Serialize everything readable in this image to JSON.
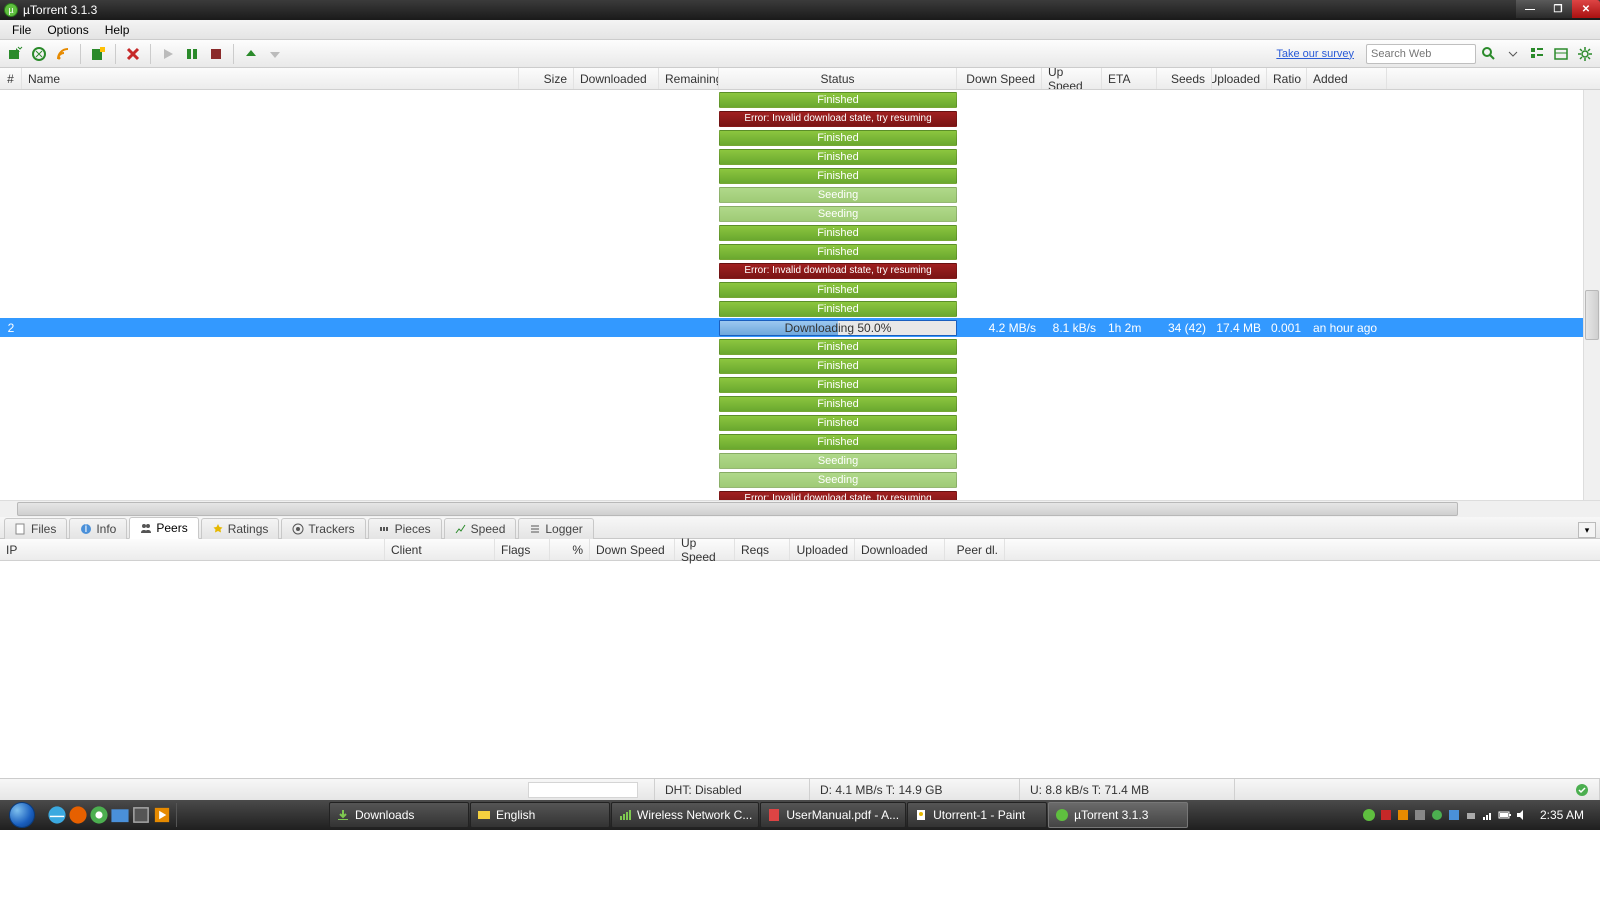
{
  "window": {
    "title": "µTorrent 3.1.3"
  },
  "menu": {
    "file": "File",
    "options": "Options",
    "help": "Help"
  },
  "toolbar": {
    "survey": "Take our survey",
    "search_placeholder": "Search Web"
  },
  "columns": {
    "num": "#",
    "name": "Name",
    "size": "Size",
    "downloaded": "Downloaded",
    "remaining": "Remaining",
    "status": "Status",
    "downspeed": "Down Speed",
    "upspeed": "Up Speed",
    "eta": "ETA",
    "seeds": "Seeds",
    "uploaded": "Uploaded",
    "ratio": "Ratio",
    "added": "Added"
  },
  "colwidths": {
    "num": 22,
    "name": 497,
    "size": 55,
    "downloaded": 85,
    "remaining": 60,
    "status": 238,
    "downspeed": 85,
    "upspeed": 60,
    "eta": 55,
    "seeds": 55,
    "uploaded": 55,
    "ratio": 40,
    "added": 80
  },
  "status_text": {
    "finished": "Finished",
    "seeding": "Seeding",
    "error": "Error: Invalid download state, try resuming",
    "downloading": "Downloading 50.0%"
  },
  "rows": [
    {
      "num": "",
      "status": "finished"
    },
    {
      "num": "",
      "status": "error"
    },
    {
      "num": "",
      "status": "finished"
    },
    {
      "num": "",
      "status": "finished"
    },
    {
      "num": "",
      "status": "finished"
    },
    {
      "num": "",
      "status": "seeding"
    },
    {
      "num": "",
      "status": "seeding"
    },
    {
      "num": "",
      "status": "finished"
    },
    {
      "num": "",
      "status": "finished"
    },
    {
      "num": "",
      "status": "error"
    },
    {
      "num": "",
      "status": "finished"
    },
    {
      "num": "",
      "status": "finished"
    },
    {
      "num": "2",
      "status": "downloading",
      "selected": true,
      "downspeed": "4.2 MB/s",
      "upspeed": "8.1 kB/s",
      "eta": "1h 2m",
      "seeds": "34 (42)",
      "uploaded": "17.4 MB",
      "ratio": "0.001",
      "added": "an hour ago"
    },
    {
      "num": "",
      "status": "finished"
    },
    {
      "num": "",
      "status": "finished"
    },
    {
      "num": "",
      "status": "finished"
    },
    {
      "num": "",
      "status": "finished"
    },
    {
      "num": "",
      "status": "finished"
    },
    {
      "num": "",
      "status": "finished"
    },
    {
      "num": "",
      "status": "seeding"
    },
    {
      "num": "",
      "status": "seeding"
    },
    {
      "num": "",
      "status": "error"
    }
  ],
  "tabs": {
    "files": "Files",
    "info": "Info",
    "peers": "Peers",
    "ratings": "Ratings",
    "trackers": "Trackers",
    "pieces": "Pieces",
    "speed": "Speed",
    "logger": "Logger"
  },
  "peercols": {
    "ip": "IP",
    "client": "Client",
    "flags": "Flags",
    "pct": "%",
    "down": "Down Speed",
    "up": "Up Speed",
    "reqs": "Reqs",
    "uploaded": "Uploaded",
    "downloaded": "Downloaded",
    "peerdl": "Peer dl."
  },
  "statusbar": {
    "dht": "DHT: Disabled",
    "down": "D: 4.1 MB/s T: 14.9 GB",
    "up": "U: 8.8 kB/s T: 71.4 MB"
  },
  "taskbar": {
    "downloads": "Downloads",
    "english": "English",
    "wireless": "Wireless Network C...",
    "usermanual": "UserManual.pdf - A...",
    "paint": "Utorrent-1 - Paint",
    "utorrent": "µTorrent 3.1.3",
    "clock": "2:35 AM"
  }
}
